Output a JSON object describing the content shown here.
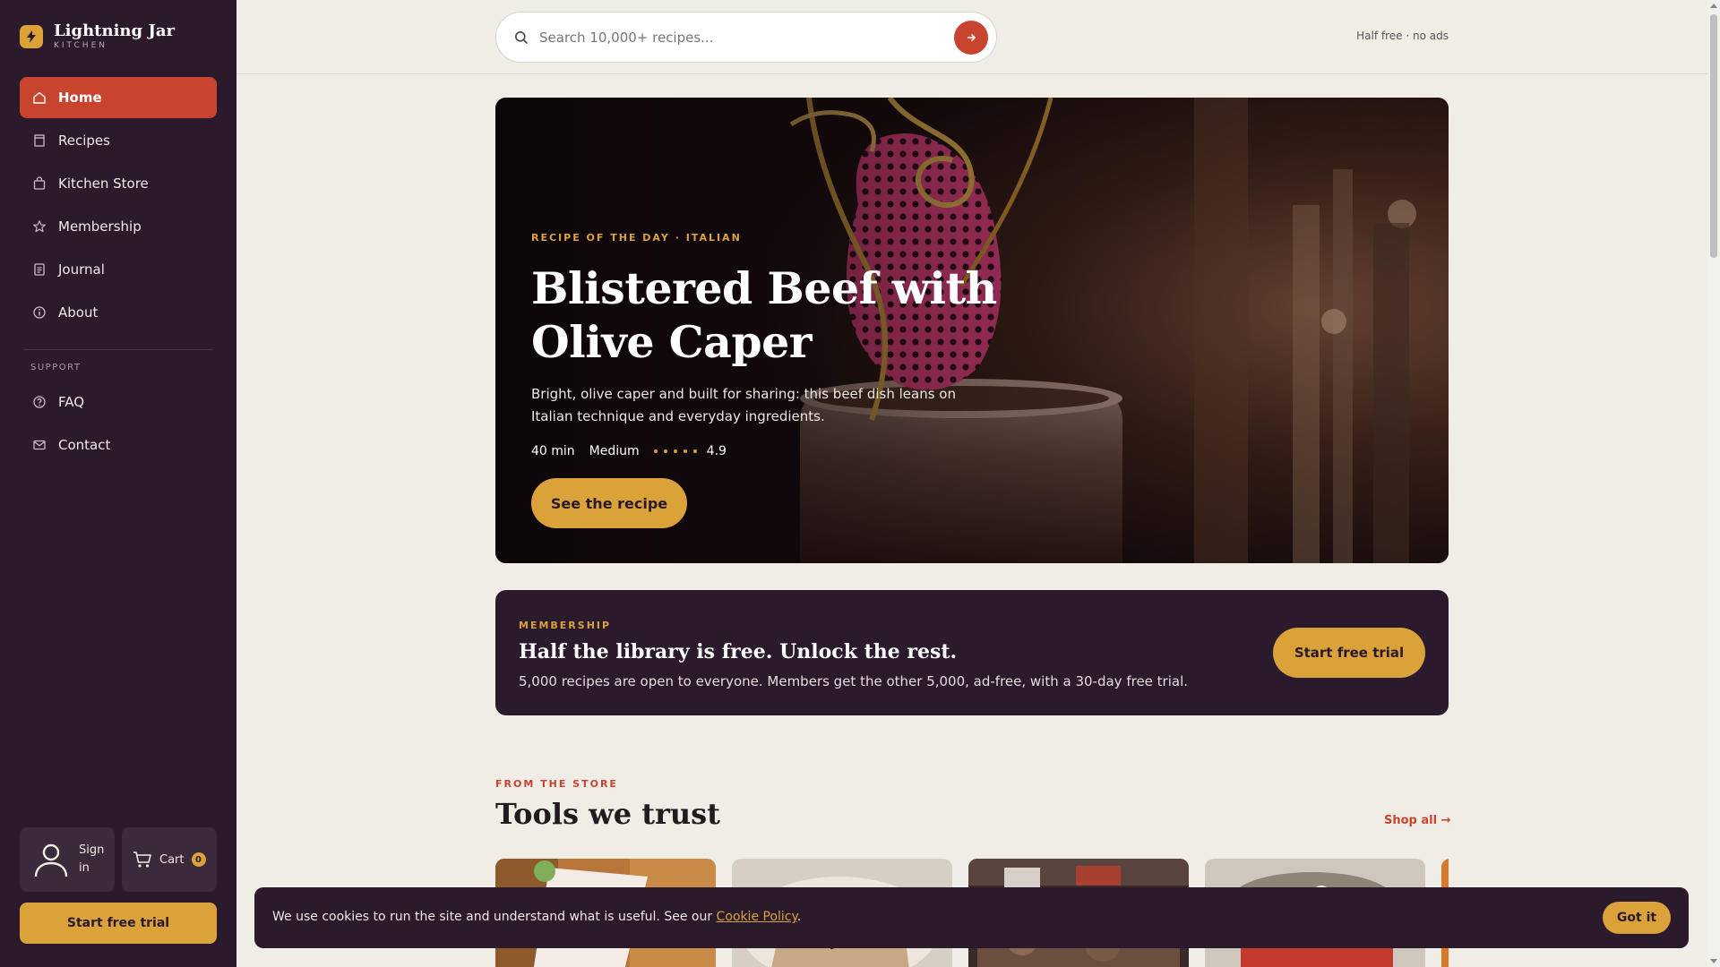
{
  "brand": {
    "name": "Lightning Jar",
    "sub": "KITCHEN"
  },
  "sidebar": {
    "items": [
      {
        "label": "Home",
        "icon": "home-icon",
        "active": true
      },
      {
        "label": "Recipes",
        "icon": "book-icon"
      },
      {
        "label": "Kitchen Store",
        "icon": "bag-icon"
      },
      {
        "label": "Membership",
        "icon": "star-icon"
      },
      {
        "label": "Journal",
        "icon": "journal-icon"
      },
      {
        "label": "About",
        "icon": "info-icon"
      }
    ],
    "support_heading": "SUPPORT",
    "support_items": [
      {
        "label": "FAQ",
        "icon": "help-icon"
      },
      {
        "label": "Contact",
        "icon": "mail-icon"
      }
    ],
    "sign_in": "Sign in",
    "cart_label": "Cart",
    "cart_count": "0",
    "trial_button": "Start free trial"
  },
  "search": {
    "placeholder": "Search 10,000+ recipes..."
  },
  "top_note": "Half free · no ads",
  "hero": {
    "eyebrow": "RECIPE OF THE DAY · ITALIAN",
    "title": "Blistered Beef with Olive Caper",
    "description": "Bright, olive caper and built for sharing: this beef dish leans on Italian technique and everyday ingredients.",
    "time": "40 min",
    "difficulty": "Medium",
    "rating": "4.9",
    "button": "See the recipe"
  },
  "membership": {
    "eyebrow": "MEMBERSHIP",
    "title": "Half the library is free. Unlock the rest.",
    "description": "5,000 recipes are open to everyone. Members get the other 5,000, ad-free, with a 30-day free trial.",
    "button": "Start free trial"
  },
  "store": {
    "eyebrow": "FROM THE STORE",
    "title": "Tools we trust",
    "shop_all": "Shop all →"
  },
  "cookie": {
    "text": "We use cookies to run the site and understand what is useful. See our",
    "link": "Cookie Policy",
    "end": ".",
    "button": "Got it"
  },
  "colors": {
    "accent": "#c9442e",
    "gold": "#dba23a",
    "sidebar": "#2a1a2c",
    "background": "#efede6"
  }
}
